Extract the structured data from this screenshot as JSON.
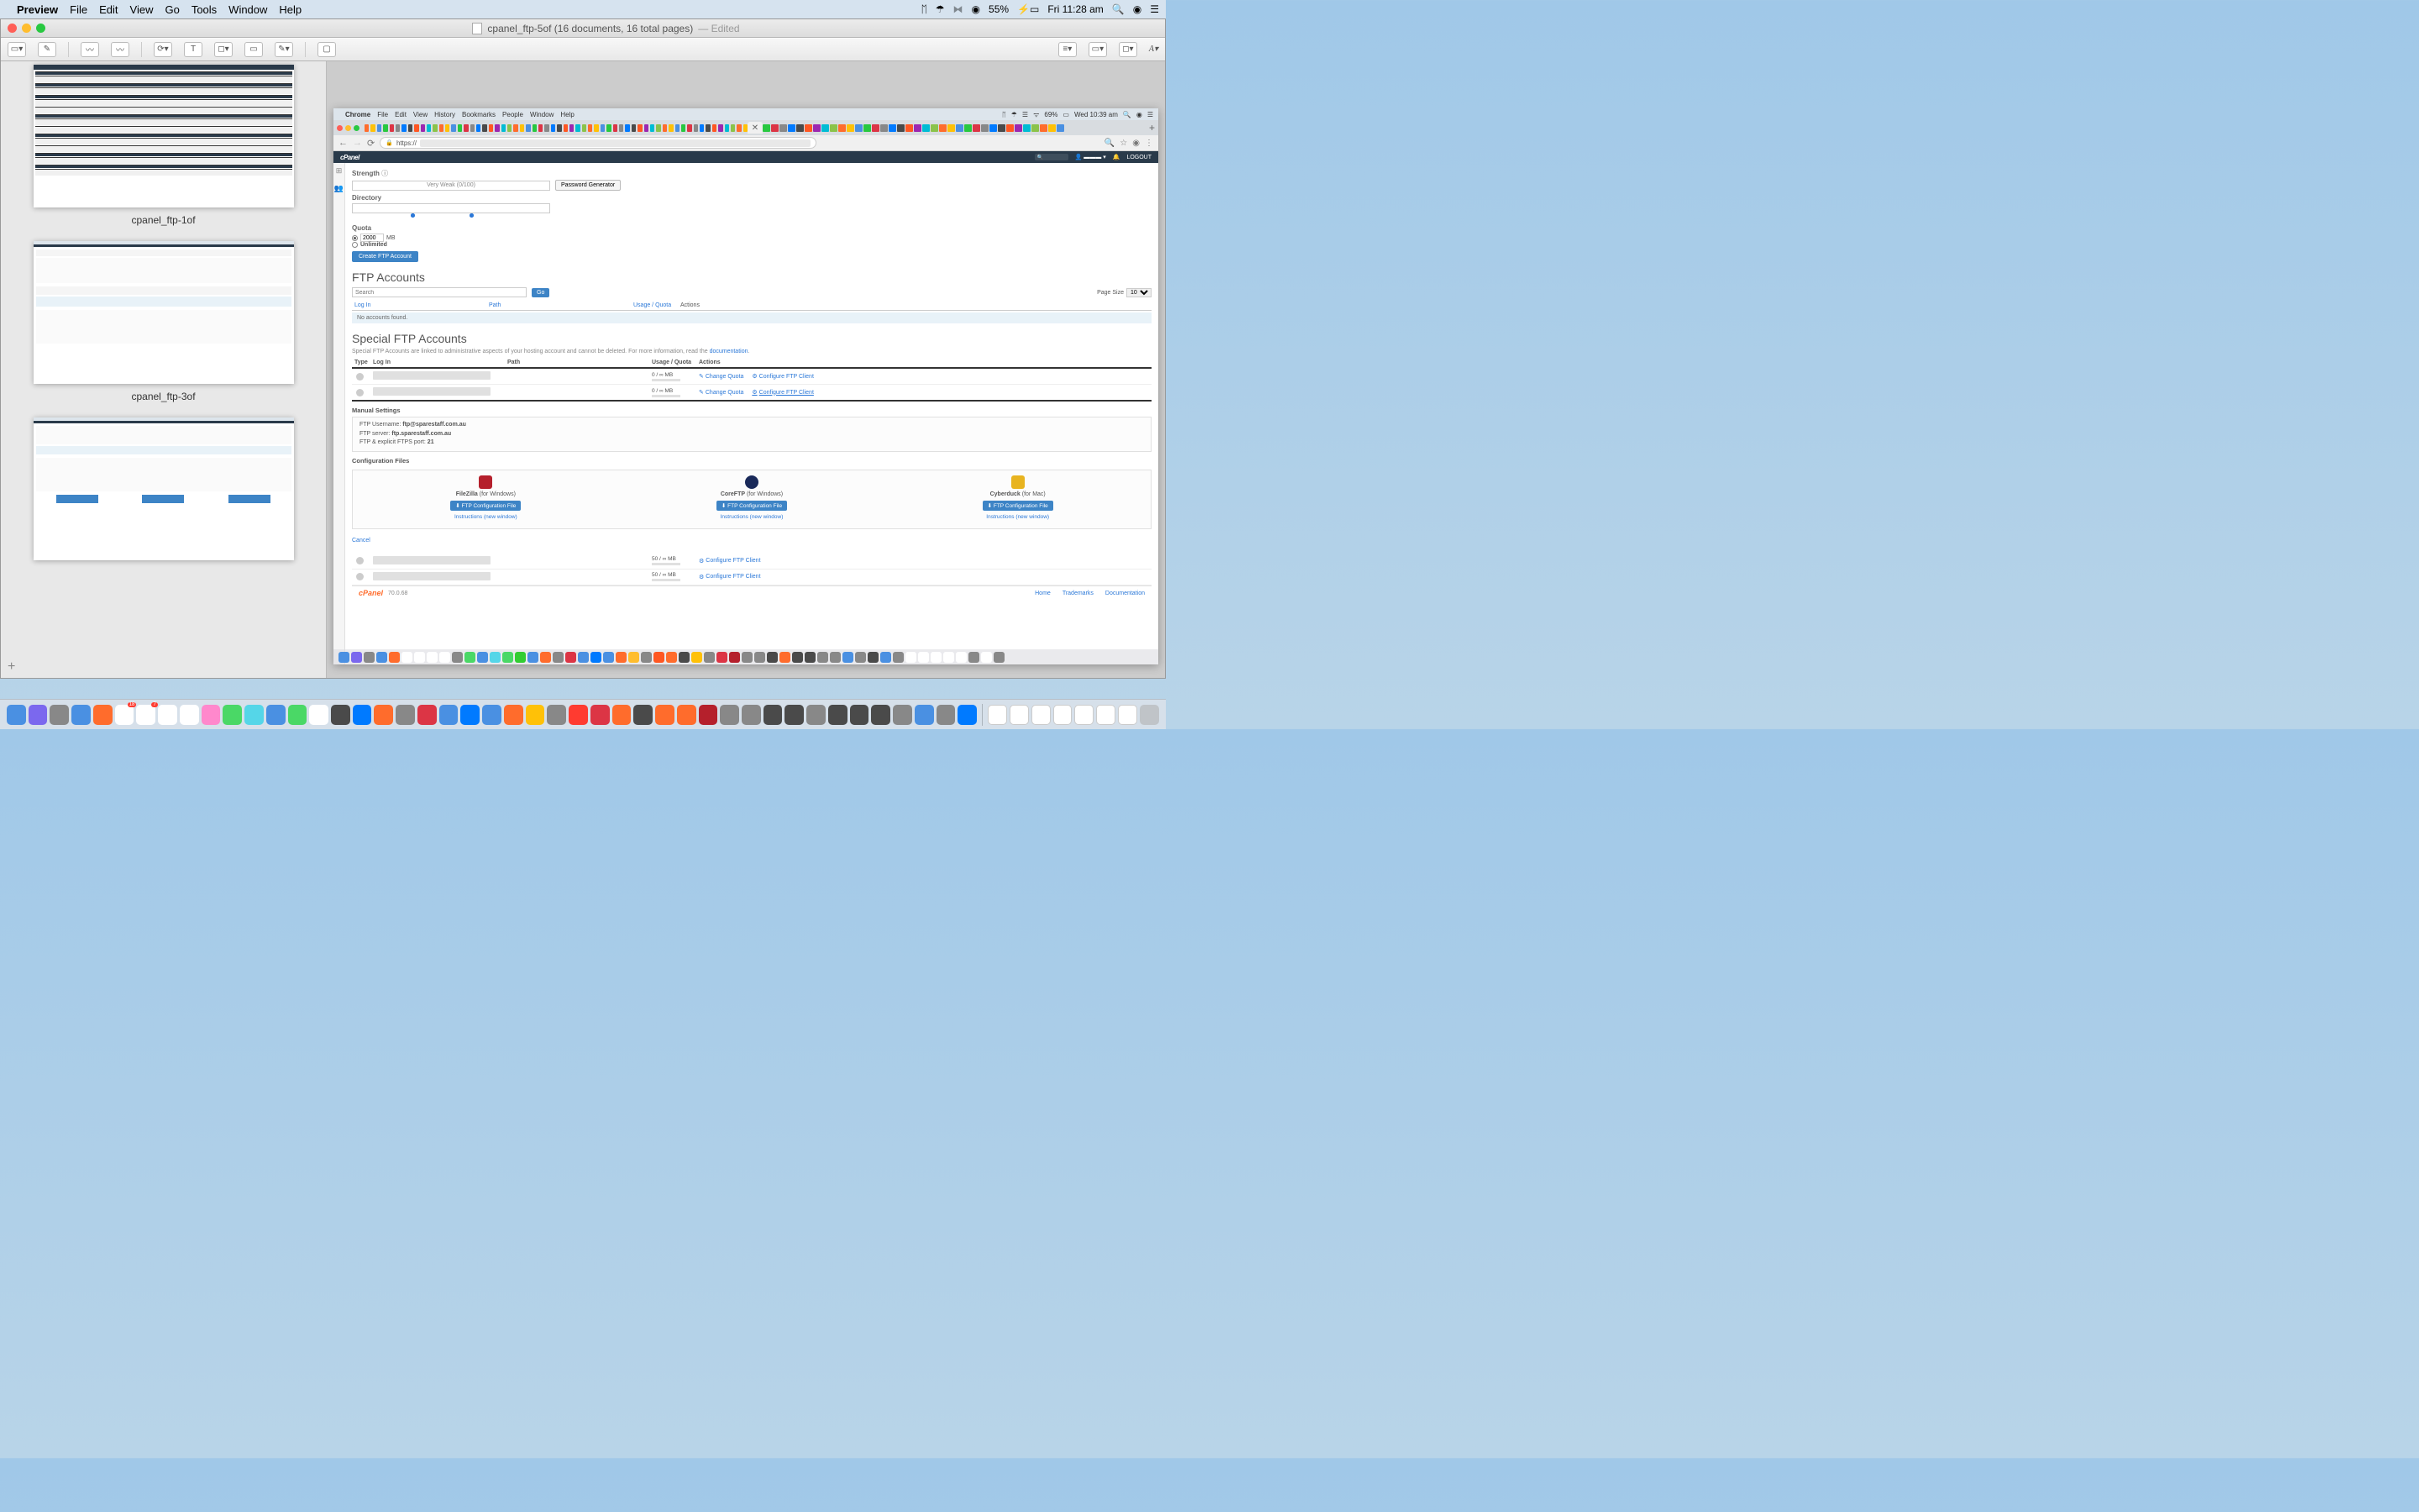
{
  "outer_menubar": {
    "app": "Preview",
    "menus": [
      "File",
      "Edit",
      "View",
      "Go",
      "Tools",
      "Window",
      "Help"
    ],
    "battery": "55%",
    "clock": "Fri 11:28 am"
  },
  "preview": {
    "title": "cpanel_ftp-5of (16 documents, 16 total pages)",
    "edited": "— Edited",
    "thumbs": [
      {
        "label": "cpanel_ftp-1of"
      },
      {
        "label": "cpanel_ftp-3of"
      },
      {
        "label": ""
      }
    ]
  },
  "inner_menubar": {
    "app": "Chrome",
    "menus": [
      "File",
      "Edit",
      "View",
      "History",
      "Bookmarks",
      "People",
      "Window",
      "Help"
    ],
    "battery": "69%",
    "clock": "Wed 10:39 am"
  },
  "addrbar": {
    "scheme": "https://"
  },
  "cpanel": {
    "logo": "cPanel",
    "search_ph": "Search ( / )",
    "logout": "LOGOUT",
    "strength": {
      "label": "Strength",
      "meter_text": "Very Weak (0/100)",
      "pwgen": "Password Generator"
    },
    "directory_label": "Directory",
    "quota": {
      "label": "Quota",
      "value": "2000",
      "unit": "MB",
      "unlimited": "Unlimited"
    },
    "create_btn": "Create FTP Account",
    "ftp_accounts": {
      "heading": "FTP Accounts",
      "search_ph": "Search",
      "go": "Go",
      "page_size_label": "Page Size",
      "page_size": "10",
      "cols": {
        "login": "Log In",
        "path": "Path",
        "uq": "Usage / Quota",
        "actions": "Actions"
      },
      "none": "No accounts found."
    },
    "special": {
      "heading": "Special FTP Accounts",
      "desc_pre": "Special FTP Accounts are linked to administrative aspects of your hosting account and cannot be deleted. For more information, read the ",
      "desc_link": "documentation",
      "cols": {
        "type": "Type",
        "login": "Log In",
        "path": "Path",
        "uq": "Usage / Quota",
        "actions": "Actions"
      },
      "rows": [
        {
          "usage": "0 / ∞ MB",
          "change_quota": "Change Quota",
          "configure": "Configure FTP Client"
        },
        {
          "usage": "0 / ∞ MB",
          "change_quota": "Change Quota",
          "configure": "Configure FTP Client"
        }
      ],
      "manual_label": "Manual Settings",
      "manual": {
        "user_l": "FTP Username:",
        "user_v": "ftp@sparestaff.com.au",
        "server_l": "FTP server:",
        "server_v": "ftp.sparestaff.com.au",
        "port_l": "FTP & explicit FTPS port:",
        "port_v": "21"
      },
      "config_label": "Configuration Files",
      "config": [
        {
          "name": "FileZilla",
          "platform": "(for Windows)",
          "btn": "FTP Configuration File",
          "instr": "Instructions (new window)",
          "color": "#b5202c"
        },
        {
          "name": "CoreFTP",
          "platform": "(for Windows)",
          "btn": "FTP Configuration File",
          "instr": "Instructions (new window)",
          "color": "#1a2a5a"
        },
        {
          "name": "Cyberduck",
          "platform": "(for Mac)",
          "btn": "FTP Configuration File",
          "instr": "Instructions (new window)",
          "color": "#e8b420"
        }
      ],
      "cancel": "Cancel",
      "bottom_rows": [
        {
          "usage": "50 / ∞ MB",
          "configure": "Configure FTP Client"
        },
        {
          "usage": "50 / ∞ MB",
          "configure": "Configure FTP Client"
        }
      ]
    },
    "footer": {
      "logo": "cPanel",
      "version": "70.0.68",
      "links": [
        "Home",
        "Trademarks",
        "Documentation"
      ]
    }
  },
  "dock_colors_inner": [
    "#4a90e2",
    "#7b68ee",
    "#888",
    "#4a90e2",
    "#ff6c2c",
    "#fff",
    "#fff",
    "#fff",
    "#fff",
    "#888",
    "#4ad866",
    "#4a90e2",
    "#55d6e8",
    "#4ad866",
    "#32cd32",
    "#4a90e2",
    "#ff6c2c",
    "#888",
    "#dc3545",
    "#4a90e2",
    "#007aff",
    "#4a90e2",
    "#ff6c2c",
    "#ffbd2e",
    "#888",
    "#ff5722",
    "#ff6c2c",
    "#4a4a4a",
    "#ffc107",
    "#888",
    "#dc3545",
    "#b5202c",
    "#888",
    "#888",
    "#4a4a4a",
    "#ff6c2c",
    "#4a4a4a",
    "#4a4a4a",
    "#888",
    "#888",
    "#4a90e2",
    "#888",
    "#4a4a4a",
    "#4a90e2",
    "#888",
    "#fff",
    "#fff",
    "#fff",
    "#fff",
    "#fff",
    "#888",
    "#fff",
    "#888"
  ],
  "dock_colors_outer": [
    "#4a90e2",
    "#7b68ee",
    "#888",
    "#4a90e2",
    "#ff6c2c",
    "#fff",
    "#fff",
    "#fff",
    "#fff",
    "#f8c",
    "#4ad866",
    "#55d6e8",
    "#4a90e2",
    "#4ad866",
    "#fff",
    "#4a4a4a",
    "#007aff",
    "#ff6c2c",
    "#888",
    "#dc3545",
    "#4a90e2",
    "#007aff",
    "#4a90e2",
    "#ff6c2c",
    "#ffc107",
    "#888",
    "#ff3b30",
    "#dc3545",
    "#ff6c2c",
    "#4a4a4a",
    "#ff6c2c",
    "#ff6c2c",
    "#b5202c",
    "#888",
    "#888",
    "#4a4a4a",
    "#4a4a4a",
    "#888",
    "#4a4a4a",
    "#4a4a4a",
    "#4a4a4a",
    "#888",
    "#4a90e2",
    "#888",
    "#007aff"
  ]
}
